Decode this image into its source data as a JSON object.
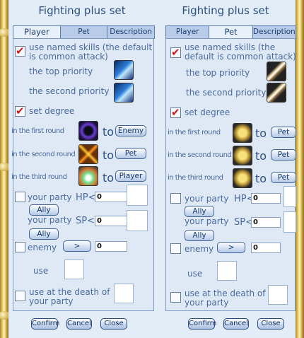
{
  "window_title": "Fighting plus set",
  "tabs": {
    "player": "Player",
    "pet": "Pet",
    "description": "Description"
  },
  "left": {
    "use_named_skills": "use named skills (the default is common attack)",
    "top_priority": "the top priority",
    "second_priority": "the second priority",
    "set_degree": "set degree",
    "first_round": "in the first round",
    "second_round": "in the second round",
    "third_round": "in the third round",
    "to": "to",
    "round1_target": "Enemy",
    "round2_target": "Pet",
    "round3_target": "Player",
    "your_party": "your party",
    "hp_label": "HP<",
    "hp_value": "0",
    "ally": "Ally",
    "your_party_2": "your party",
    "sp_label": "SP<",
    "sp_value": "0",
    "ally_2": "Ally",
    "enemy": "enemy",
    "enemy_select": ">",
    "enemy_value": "0",
    "use": "use",
    "use_at_death": "use at the death of your party"
  },
  "right": {
    "use_named_skills": "use named skills (the default is common attack)",
    "top_priority": "the top priority",
    "second_priority": "the second priority",
    "set_degree": "set degree",
    "first_round": "in the first round",
    "second_round": "in the second round",
    "third_round": "in the third round",
    "to": "to",
    "round1_target": "Pet",
    "round2_target": "Pet",
    "round3_target": "Pet",
    "your_party": "your party",
    "hp_label": "HP<",
    "hp_value": "0",
    "ally": "Ally",
    "your_party_2": "your party",
    "sp_label": "SP<",
    "sp_value": "0",
    "ally_2": "Ally",
    "enemy": "enemy",
    "enemy_select": ">",
    "enemy_value": "0",
    "use": "use",
    "use_at_death": "use at the death of your party"
  },
  "buttons": {
    "confirm": "Confirm",
    "cancel": "Cancel",
    "close": "Close"
  },
  "icons": {
    "left_top": "sky-wing-skill-icon",
    "left_second": "sky-wing-skill-icon",
    "left_r1": "void-circle-skill-icon",
    "left_r2": "crossed-swords-skill-icon",
    "left_r3": "heal-skill-icon",
    "right_top": "sword-skill-icon",
    "right_second": "sword-skill-icon",
    "right_rounds": "pet-emblem-icon"
  },
  "colors": {
    "background": "#dfe9f6",
    "text": "#4a6a9c",
    "check": "#d01818",
    "frame": "#d9b64f"
  }
}
